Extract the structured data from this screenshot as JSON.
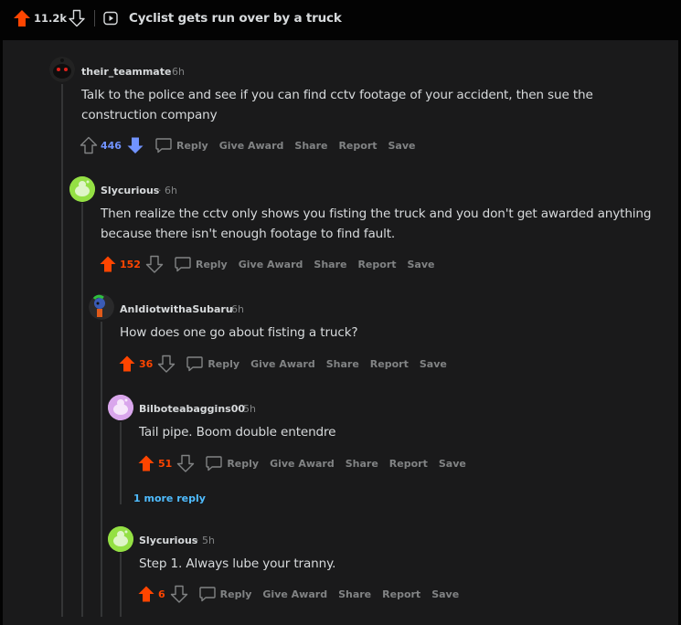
{
  "post": {
    "score": "11.2k",
    "title": "Cyclist gets run over by a truck"
  },
  "actions": {
    "reply": "Reply",
    "award": "Give Award",
    "share": "Share",
    "report": "Report",
    "save": "Save"
  },
  "comments": [
    {
      "user": "their_teammate",
      "time": "· 6h",
      "text": "Talk to the police and see if you can find cctv footage of your accident, then sue the construction company",
      "score": "446",
      "vote": "down"
    },
    {
      "user": "Slycurious",
      "time": "· 6h",
      "text": "Then realize the cctv only shows you fisting the truck and you don't get awarded anything because there isn't enough footage to find fault.",
      "score": "152",
      "vote": "up"
    },
    {
      "user": "AnIdiotwithaSubaru",
      "time": "· 6h",
      "text": "How does one go about fisting a truck?",
      "score": "36",
      "vote": "up"
    },
    {
      "user": "Bilboteabaggins00",
      "time": "· 5h",
      "text": "Tail pipe. Boom double entendre",
      "score": "51",
      "vote": "up"
    },
    {
      "user": "Slycurious",
      "time": "· 5h",
      "text": "Step 1. Always lube your tranny.",
      "score": "6",
      "vote": "up"
    }
  ],
  "more_replies": "1 more reply",
  "colors": {
    "upvote": "#ff4500",
    "downvote": "#7193ff",
    "link": "#4fbcff"
  }
}
